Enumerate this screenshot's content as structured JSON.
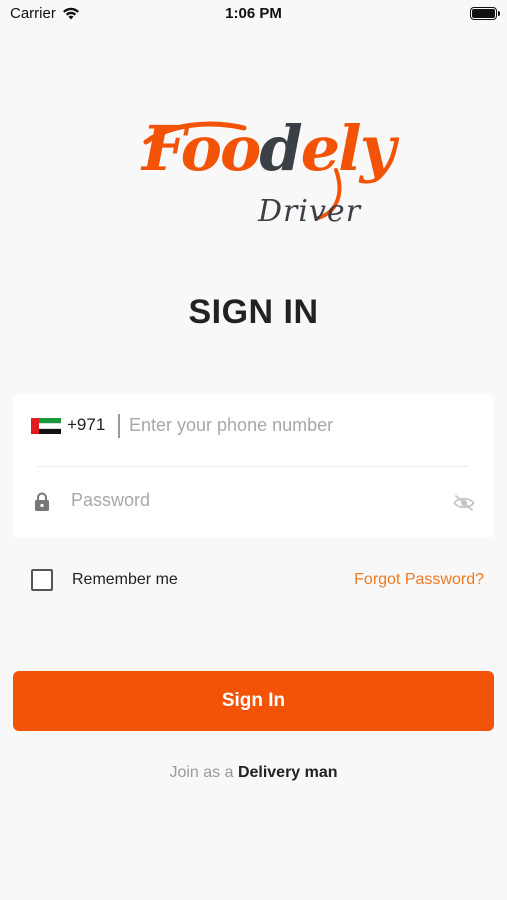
{
  "status_bar": {
    "carrier": "Carrier",
    "time": "1:06 PM",
    "wifi_icon": "wifi-icon",
    "battery_icon": "battery-icon"
  },
  "logo": {
    "part1": "Foo",
    "part2": "d",
    "part3": "ely",
    "subtitle": "Driver"
  },
  "page_title": "SIGN IN",
  "form": {
    "country_code": "+971",
    "country_flag": "uae-flag",
    "phone_placeholder": "Enter your phone number",
    "phone_value": "",
    "password_placeholder": "Password",
    "password_value": "",
    "lock_icon": "lock-icon",
    "visibility_icon": "eye-off-icon"
  },
  "remember": {
    "label": "Remember me",
    "checked": false
  },
  "forgot_password": "Forgot Password?",
  "sign_in_label": "Sign In",
  "join": {
    "prefix": "Join as a",
    "link": "Delivery man"
  },
  "colors": {
    "brand_orange": "#f25307",
    "link_orange": "#ee7a22",
    "logo_dark": "#3b3f46",
    "background": "#f8f8f8"
  }
}
